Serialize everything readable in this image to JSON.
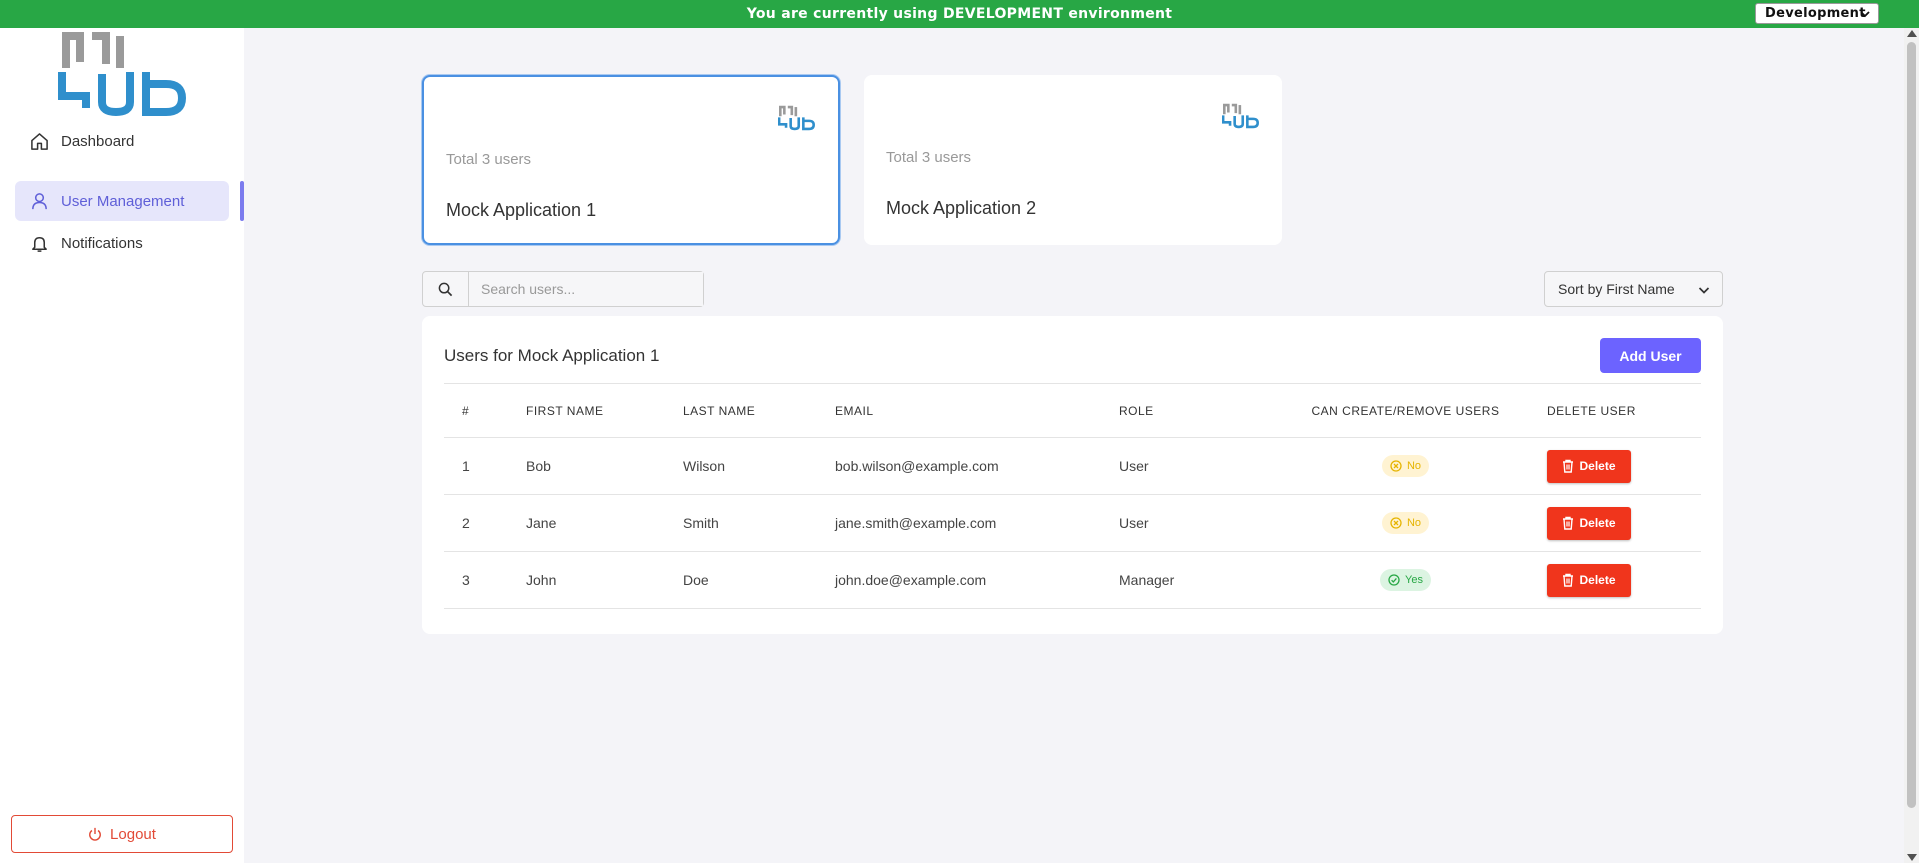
{
  "env": {
    "message": "You are currently using DEVELOPMENT environment",
    "selected": "Development",
    "bar_color": "#28a745"
  },
  "sidebar": {
    "items": [
      {
        "label": "Dashboard",
        "icon": "home-icon"
      },
      {
        "label": "User Management",
        "icon": "user-icon",
        "active": true
      },
      {
        "label": "Notifications",
        "icon": "bell-icon"
      }
    ],
    "logout_label": "Logout"
  },
  "apps": [
    {
      "count_text": "Total 3 users",
      "name": "Mock Application 1",
      "selected": true
    },
    {
      "count_text": "Total 3 users",
      "name": "Mock Application 2",
      "selected": false
    }
  ],
  "search": {
    "placeholder": "Search users..."
  },
  "sort": {
    "selected": "Sort by First Name"
  },
  "panel": {
    "title": "Users for Mock Application 1",
    "add_user_label": "Add User"
  },
  "table": {
    "headers": [
      "#",
      "FIRST NAME",
      "LAST NAME",
      "EMAIL",
      "ROLE",
      "CAN CREATE/REMOVE USERS",
      "DELETE USER"
    ],
    "rows": [
      {
        "idx": "1",
        "first": "Bob",
        "last": "Wilson",
        "email": "bob.wilson@example.com",
        "role": "User",
        "can": "No",
        "delete": "Delete"
      },
      {
        "idx": "2",
        "first": "Jane",
        "last": "Smith",
        "email": "jane.smith@example.com",
        "role": "User",
        "can": "No",
        "delete": "Delete"
      },
      {
        "idx": "3",
        "first": "John",
        "last": "Doe",
        "email": "john.doe@example.com",
        "role": "Manager",
        "can": "Yes",
        "delete": "Delete"
      }
    ]
  },
  "colors": {
    "accent": "#6c63ff",
    "danger": "#f0351c",
    "logo_blue": "#2f8fcc",
    "logo_gray": "#9a9a9a"
  }
}
